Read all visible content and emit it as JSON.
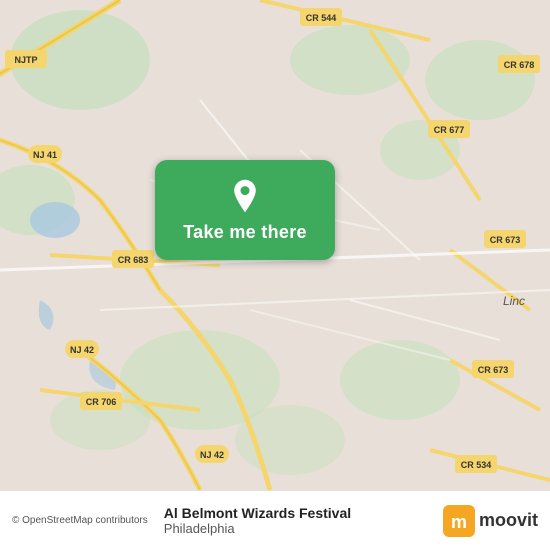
{
  "map": {
    "attribution": "© OpenStreetMap contributors",
    "bg_color": "#e8e0d8"
  },
  "button": {
    "label": "Take me there",
    "icon": "location-pin"
  },
  "bottom_bar": {
    "destination_name": "Al Belmont Wizards Festival",
    "destination_city": "Philadelphia",
    "logo_text": "moovit"
  }
}
